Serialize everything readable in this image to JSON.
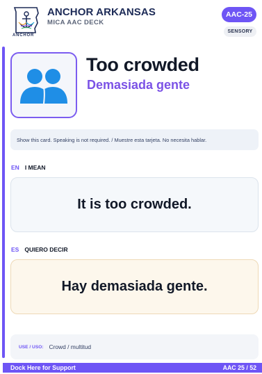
{
  "brand": {
    "title": "ANCHOR ARKANSAS",
    "subtitle": "MICA AAC DECK",
    "logo_text": "ANCHOR"
  },
  "badges": {
    "code": "AAC-25",
    "category": "SENSORY"
  },
  "card": {
    "icon": "two-people-icon",
    "title_en": "Too crowded",
    "title_es": "Demasiada gente",
    "instruction": "Show this card. Speaking is not required. / Muestre esta tarjeta. No necesita hablar."
  },
  "en_section": {
    "lang": "EN",
    "label": "I MEAN",
    "phrase": "It is too crowded."
  },
  "es_section": {
    "lang": "ES",
    "label": "QUIERO DECIR",
    "phrase": "Hay demasiada gente."
  },
  "use": {
    "label": "USE / USO:",
    "value": "Crowd / multitud"
  },
  "footer": {
    "left": "Dock Here for Support",
    "right": "AAC 25 / 52"
  },
  "colors": {
    "accent": "#6e55f5",
    "title_es": "#7b52e6",
    "icon_blue": "#1f8ee6",
    "es_box": "#fdf7ec",
    "en_box": "#f5f8fb"
  }
}
